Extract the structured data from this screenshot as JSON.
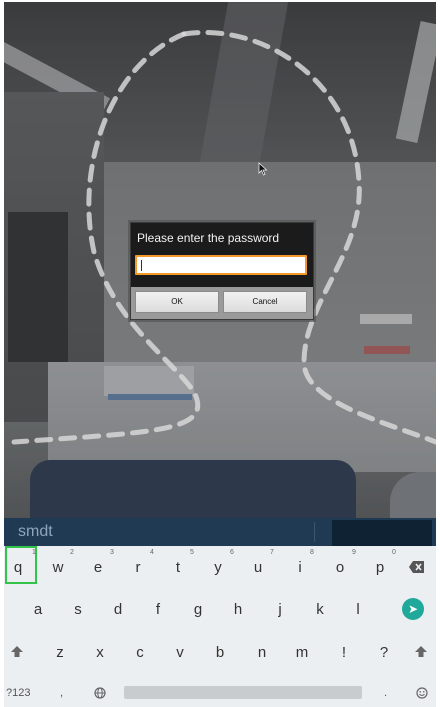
{
  "dialog": {
    "title": "Please enter the password",
    "password_value": "",
    "ok_label": "OK",
    "cancel_label": "Cancel",
    "accent_color": "#f39a2b"
  },
  "suggestion": {
    "text": "smdt"
  },
  "keyboard": {
    "row1": [
      {
        "key": "q",
        "hint": "1"
      },
      {
        "key": "w",
        "hint": "2"
      },
      {
        "key": "e",
        "hint": "3"
      },
      {
        "key": "r",
        "hint": "4"
      },
      {
        "key": "t",
        "hint": "5"
      },
      {
        "key": "y",
        "hint": "6"
      },
      {
        "key": "u",
        "hint": "7"
      },
      {
        "key": "i",
        "hint": "8"
      },
      {
        "key": "o",
        "hint": "9"
      },
      {
        "key": "p",
        "hint": "0"
      }
    ],
    "row2": [
      "a",
      "s",
      "d",
      "f",
      "g",
      "h",
      "j",
      "k",
      "l"
    ],
    "row3": [
      "z",
      "x",
      "c",
      "v",
      "b",
      "n",
      "m",
      "!",
      "?"
    ],
    "symbols_label": "?123",
    "comma_label": ",",
    "period_label": ".",
    "icons": {
      "backspace": "backspace-icon",
      "enter": "enter-icon",
      "shift": "shift-icon",
      "globe": "globe-icon",
      "emoji": "emoji-icon"
    },
    "enter_color": "#20a89a",
    "highlight_color": "#34c34a"
  }
}
